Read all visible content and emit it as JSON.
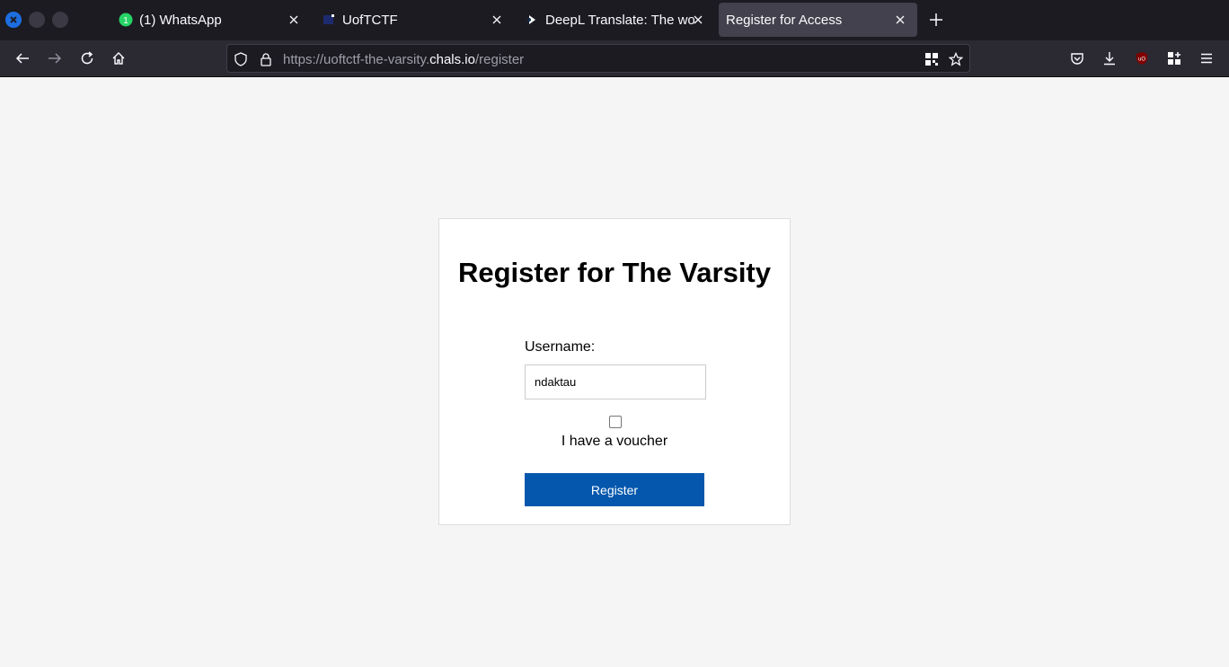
{
  "browser": {
    "tabs": [
      {
        "title": "(1) WhatsApp",
        "favicon": "whatsapp-icon",
        "badge": "1"
      },
      {
        "title": "UofTCTF",
        "favicon": "uoftctf-icon"
      },
      {
        "title": "DeepL Translate: The wor",
        "favicon": "deepl-icon"
      },
      {
        "title": "Register for Access",
        "favicon": "",
        "active": true
      }
    ],
    "url": {
      "prefix": "https://uoftctf-the-varsity.",
      "host": "chals.io",
      "path": "/register"
    },
    "colors": {
      "accent": "#1d6fe0",
      "tab_bar": "#1c1b22",
      "nav_bar": "#2b2a33"
    }
  },
  "page": {
    "title": "Register for The Varsity",
    "username_label": "Username:",
    "username_value": "ndaktau",
    "voucher_label": "I have a voucher",
    "voucher_checked": false,
    "submit_label": "Register",
    "colors": {
      "button": "#0457ad",
      "background": "#f5f5f5"
    }
  }
}
